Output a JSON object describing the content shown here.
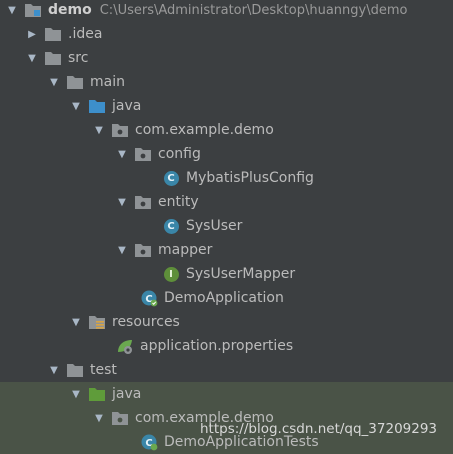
{
  "project": {
    "name": "demo",
    "path": "C:\\Users\\Administrator\\Desktop\\huanngy\\demo"
  },
  "nodes": {
    "idea": ".idea",
    "src": "src",
    "main": "main",
    "main_java": "java",
    "main_pkg": "com.example.demo",
    "config": "config",
    "mybatis": "MybatisPlusConfig",
    "entity": "entity",
    "sysuser": "SysUser",
    "mapper": "mapper",
    "sysusermapper": "SysUserMapper",
    "demoapp": "DemoApplication",
    "resources": "resources",
    "appprops": "application.properties",
    "test": "test",
    "test_java": "java",
    "test_pkg": "com.example.demo",
    "demotests": "DemoApplicationTests"
  },
  "icon_letters": {
    "class": "C",
    "interface": "I"
  },
  "watermark": "https://blog.csdn.net/qq_37209293",
  "colors": {
    "background": "#3c3f41",
    "highlight_row": "#4a5347",
    "text": "#bbbbbb",
    "folder_gray": "#8f9396",
    "source_root_blue": "#3d8fcb",
    "test_root_green": "#5f9c3a",
    "class_icon": "#3a86a8",
    "interface_icon": "#5e8f3a"
  }
}
